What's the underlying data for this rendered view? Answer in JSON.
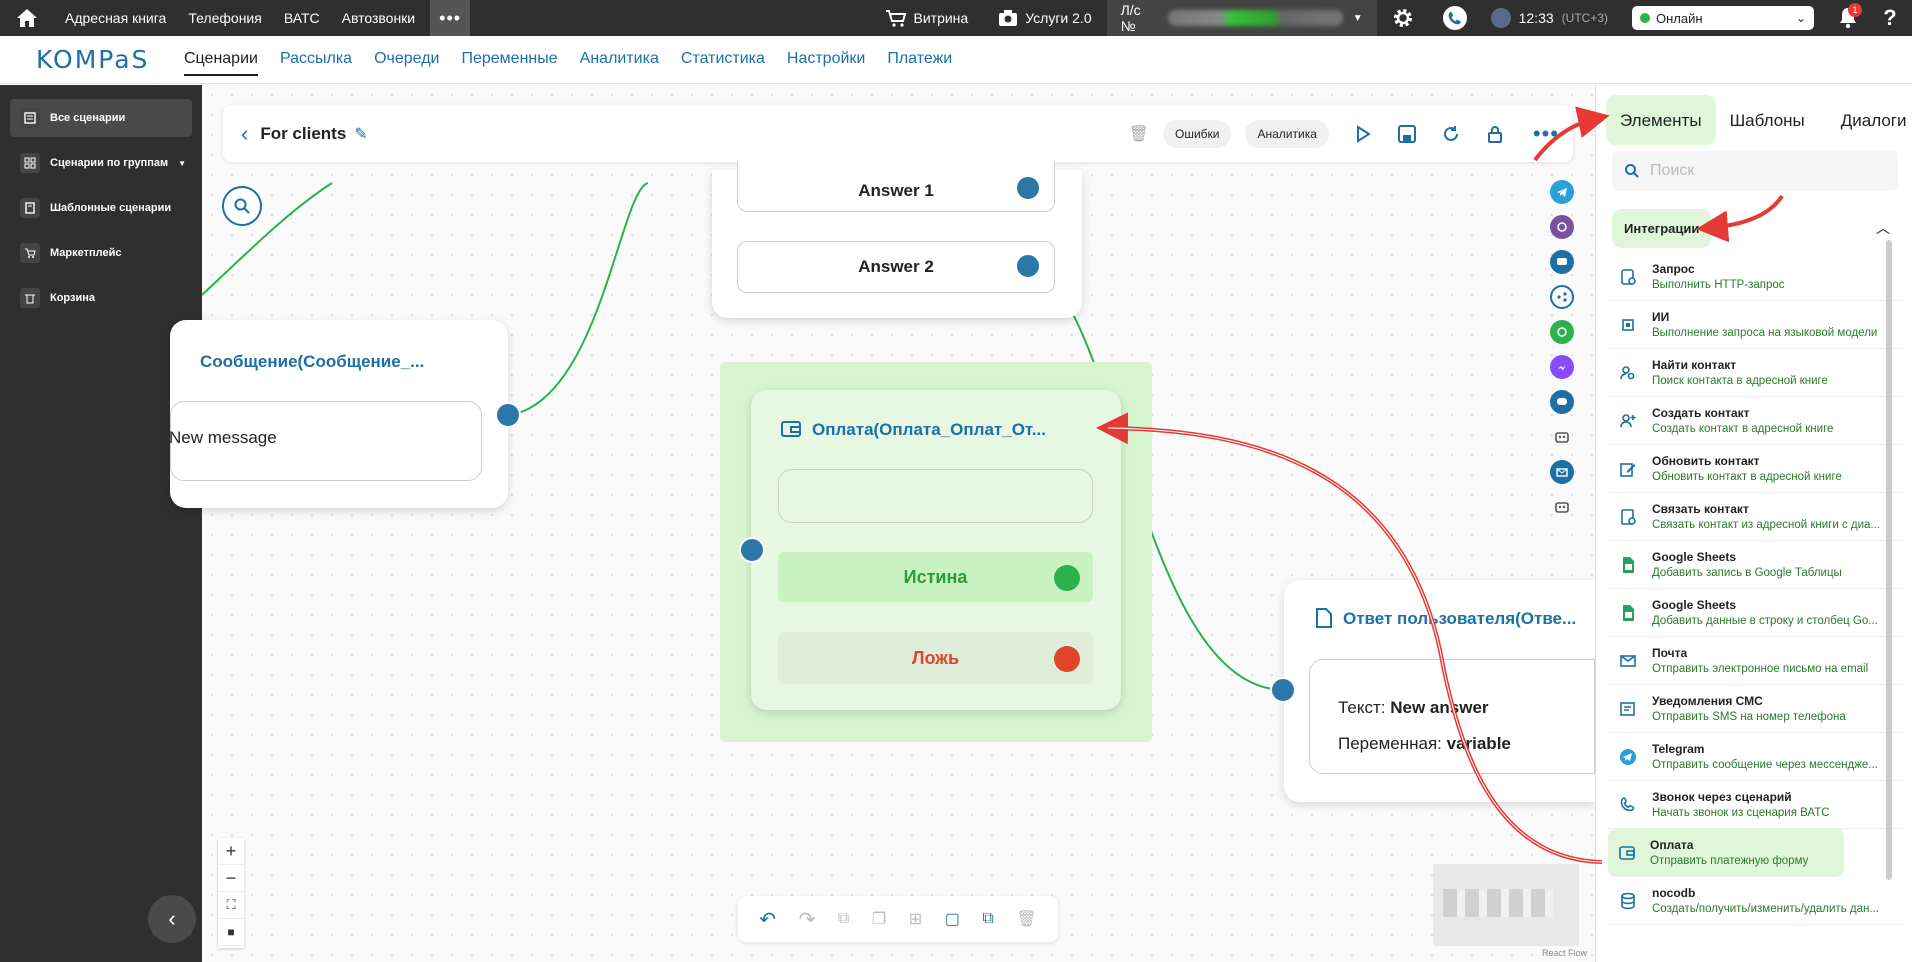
{
  "topbar": {
    "nav": [
      "Адресная книга",
      "Телефония",
      "ВАТС",
      "Автозвонки"
    ],
    "more": "•••",
    "showcase": "Витрина",
    "services": "Услуги 2.0",
    "account_label": "Л/с №",
    "time": "12:33",
    "timezone": "(UTC+3)",
    "status": "Онлайн",
    "notifications": "1",
    "help": "?"
  },
  "logo": "KOMPaS",
  "mainnav": [
    "Сценарии",
    "Рассылка",
    "Очереди",
    "Переменные",
    "Аналитика",
    "Статистика",
    "Настройки",
    "Платежи"
  ],
  "sidebar": [
    "Все сценарии",
    "Сценарии по группам",
    "Шаблонные сценарии",
    "Маркетплейс",
    "Корзина"
  ],
  "toolbar": {
    "title": "For clients",
    "errors": "Ошибки",
    "analytics": "Аналитика"
  },
  "nodes": {
    "message_title": "Сообщение(Сообщение_...",
    "message_text": "New message",
    "answer1": "Answer 1",
    "answer2": "Answer 2",
    "payment_title": "Оплата(Оплата_Оплат_От...",
    "true_label": "Истина",
    "false_label": "Ложь",
    "reply_title": "Ответ пользователя(Отве...",
    "reply_text_label": "Текст: ",
    "reply_text": "New answer",
    "reply_var_label": "Переменная: ",
    "reply_var": "variable"
  },
  "reactflow": "React Flow",
  "panel": {
    "tabs": [
      "Элементы",
      "Шаблоны",
      "Диалоги"
    ],
    "search_placeholder": "Поиск",
    "section": "Интеграции",
    "items": [
      {
        "title": "Запрос",
        "desc": "Выполнить HTTP-запрос",
        "icon": "request-icon"
      },
      {
        "title": "ИИ",
        "desc": "Выполнение запроса на языковой модели",
        "icon": "ai-chip-icon"
      },
      {
        "title": "Найти контакт",
        "desc": "Поиск контакта в адресной книге",
        "icon": "find-contact-icon"
      },
      {
        "title": "Создать контакт",
        "desc": "Создать контакт в адресной книге",
        "icon": "add-contact-icon"
      },
      {
        "title": "Обновить контакт",
        "desc": "Обновить контакт в адресной книге",
        "icon": "edit-contact-icon"
      },
      {
        "title": "Связать контакт",
        "desc": "Связать контакт из адресной книги с диа...",
        "icon": "link-contact-icon"
      },
      {
        "title": "Google Sheets",
        "desc": "Добавить запись в Google Таблицы",
        "icon": "google-sheets-icon"
      },
      {
        "title": "Google Sheets",
        "desc": "Добавить данные в строку и столбец Go...",
        "icon": "google-sheets-icon"
      },
      {
        "title": "Почта",
        "desc": "Отправить электронное письмо на email",
        "icon": "mail-icon"
      },
      {
        "title": "Уведомления СМС",
        "desc": "Отправить SMS на номер телефона",
        "icon": "sms-icon"
      },
      {
        "title": "Telegram",
        "desc": "Отправить сообщение через мессендже...",
        "icon": "telegram-icon"
      },
      {
        "title": "Звонок через сценарий",
        "desc": "Начать звонок из сценария ВАТС",
        "icon": "call-icon"
      },
      {
        "title": "Оплата",
        "desc": "Отправить платежную форму",
        "icon": "payment-icon"
      },
      {
        "title": "nocodb",
        "desc": "Создать/получить/изменить/удалить дан...",
        "icon": "database-icon"
      }
    ]
  },
  "colors": {
    "accent": "#1d6fa5",
    "green_highlight": "#dff7d8",
    "edge": "#2bb24c",
    "port": "#2a77a8",
    "arrow": "#e53935"
  }
}
